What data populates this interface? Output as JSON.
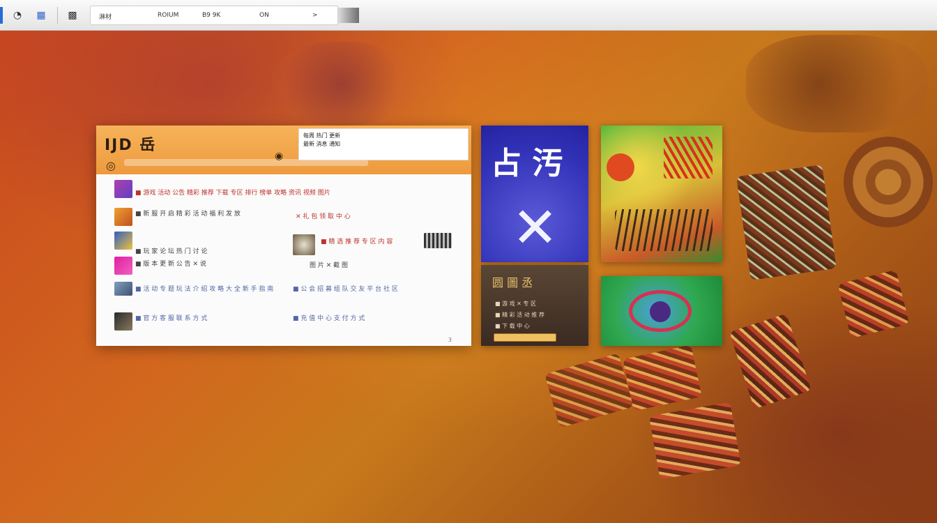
{
  "toolbar": {
    "tab1": "淋材",
    "tab2": "ROIUM",
    "tab3": "B9 9K",
    "tab4": "ON",
    "more": ">"
  },
  "window": {
    "logo": "IJD 岳",
    "notice_line1": "每周 热门 更新",
    "notice_line2": "最新 消息 通知",
    "rows": [
      {
        "a": "■ 游戏 活动 公告 精彩 推荐 下载 专区 排行 榜单 攻略 资讯 视频 图片",
        "b": ""
      },
      {
        "a": "■ 新 服 开 启 精 彩 活 动 福 利 发 放",
        "b": "✕ 礼 包 领 取 中 心"
      },
      {
        "a": "■ 玩 家 论 坛 热 门 讨 论",
        "b": "■ 精 选 推 荐 专 区 内 容"
      },
      {
        "a": "■ 版 本 更 新 公 告 ✕ 说",
        "b": "图 片 ✕ 截 图"
      },
      {
        "a": "■ 活 动 专 题 玩 法 介 绍 攻 略 大 全 新 手 指 南",
        "b": "■ 公 会 招 募 组 队 交 友 平 台 社 区"
      },
      {
        "a": "■ 官 方 客 服 联 系 方 式",
        "b": "■ 充 值 中 心 支 付 方 式"
      }
    ],
    "footer": "3"
  },
  "tiles": {
    "blue_glyph": "占 汚",
    "blue_x": "✕",
    "dark_title": "圆 圖 丞",
    "dark_line1": "■ 游 戏 ✕ 专 区",
    "dark_line2": "■ 精 彩 活 动 推 荐",
    "dark_line3": "■ 下 载 中 心"
  },
  "colors": {
    "accent": "#2a6bd6",
    "header_orange": "#ee9a3d",
    "tile_blue": "#3232b8"
  }
}
